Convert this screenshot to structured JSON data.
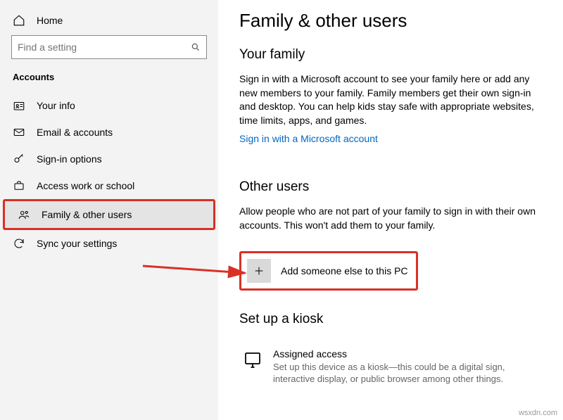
{
  "sidebar": {
    "home": "Home",
    "searchPlaceholder": "Find a setting",
    "sectionTitle": "Accounts",
    "items": [
      {
        "label": "Your info"
      },
      {
        "label": "Email & accounts"
      },
      {
        "label": "Sign-in options"
      },
      {
        "label": "Access work or school"
      },
      {
        "label": "Family & other users"
      },
      {
        "label": "Sync your settings"
      }
    ]
  },
  "main": {
    "pageTitle": "Family & other users",
    "family": {
      "heading": "Your family",
      "body": "Sign in with a Microsoft account to see your family here or add any new members to your family. Family members get their own sign-in and desktop. You can help kids stay safe with appropriate websites, time limits, apps, and games.",
      "linkText": "Sign in with a Microsoft account"
    },
    "otherUsers": {
      "heading": "Other users",
      "body": "Allow people who are not part of your family to sign in with their own accounts. This won't add them to your family.",
      "addLabel": "Add someone else to this PC"
    },
    "kiosk": {
      "heading": "Set up a kiosk",
      "title": "Assigned access",
      "desc": "Set up this device as a kiosk—this could be a digital sign, interactive display, or public browser among other things."
    }
  },
  "watermark": "wsxdn.com"
}
